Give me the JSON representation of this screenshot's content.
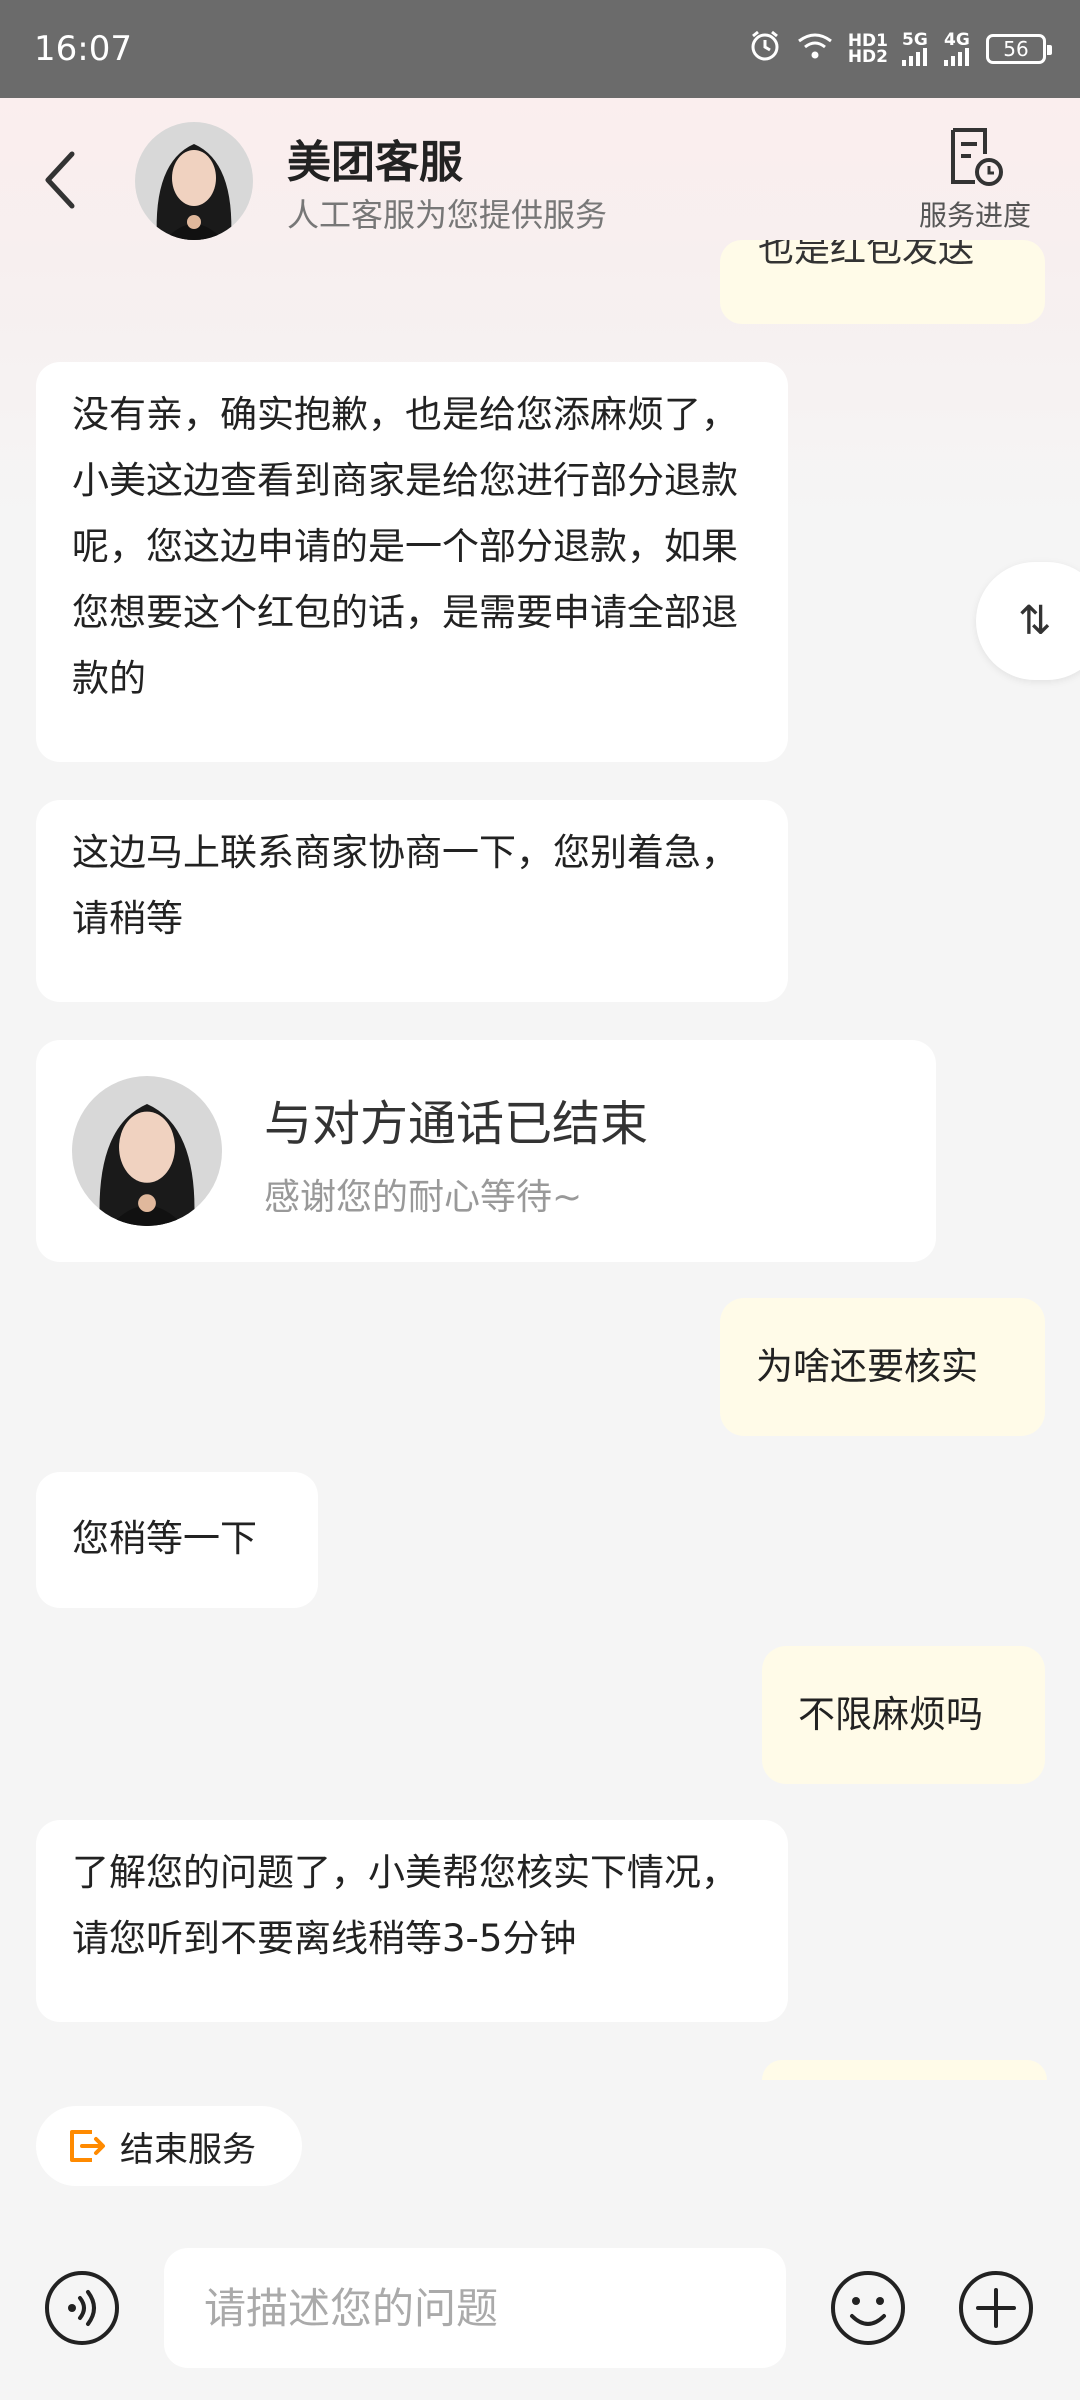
{
  "status_bar": {
    "time": "16:07",
    "network_top": "HD1",
    "network_bottom": "HD2",
    "net_5g": "5G",
    "net_4g": "4G",
    "battery": "56",
    "icons": [
      "alarm-icon",
      "wifi-icon",
      "signal-icon",
      "battery-icon"
    ]
  },
  "header": {
    "title": "美团客服",
    "subtitle": "人工客服为您提供服务",
    "service_progress_label": "服务进度"
  },
  "messages": {
    "partial_top": "也是红包发送",
    "m1": "没有亲，确实抱歉，也是给您添麻烦了，小美这边查看到商家是给您进行部分退款呢，您这边申请的是一个部分退款，如果您想要这个红包的话，是需要申请全部退款的",
    "m2": "这边马上联系商家协商一下，您别着急，请稍等",
    "call_title": "与对方通话已结束",
    "call_sub": "感谢您的耐心等待~",
    "m3": "为啥还要核实",
    "m4": "您稍等一下",
    "m5": "不限麻烦吗",
    "m6": "了解您的问题了，小美帮您核实下情况，请您听到不要离线稍等3-5分钟"
  },
  "scroll_toggle": "⇅",
  "end_service_label": "结束服务",
  "input": {
    "placeholder": "请描述您的问题"
  },
  "colors": {
    "accent_orange": "#ff8a00",
    "self_bubble": "#fffbe8",
    "other_bubble": "#ffffff"
  }
}
